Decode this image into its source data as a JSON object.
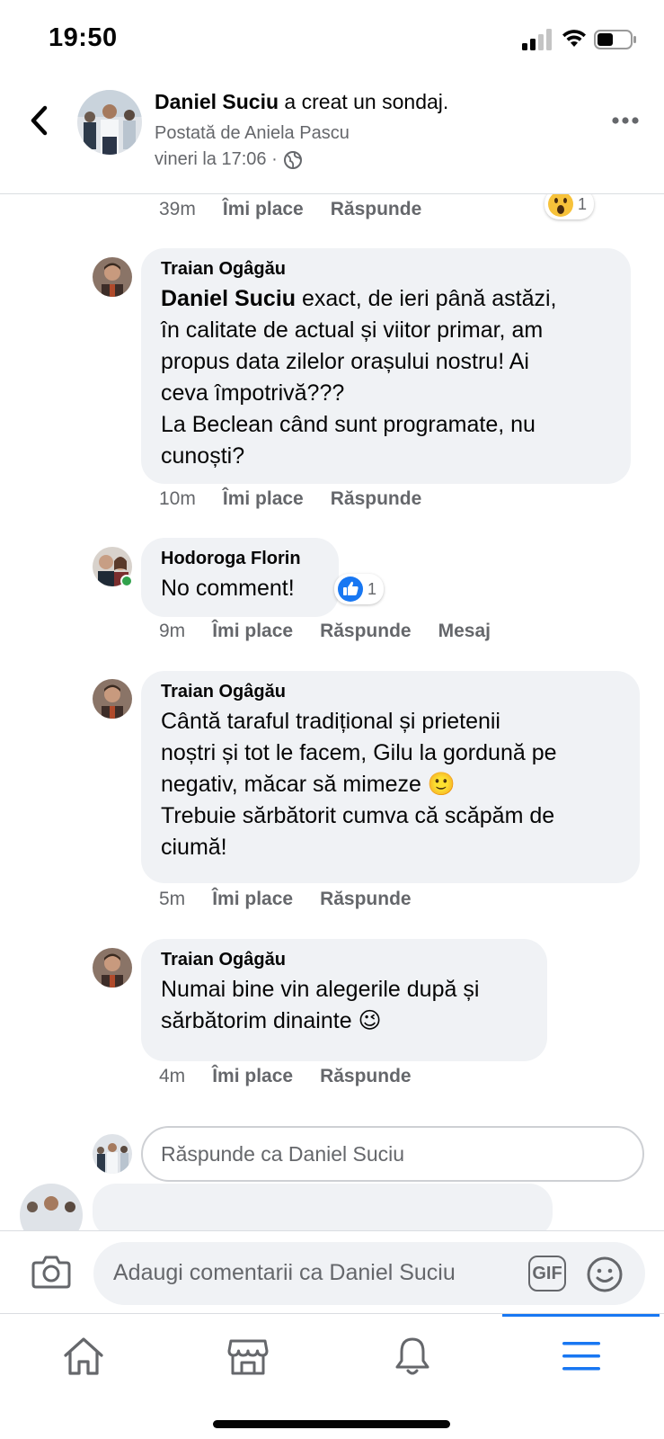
{
  "status": {
    "time": "19:50"
  },
  "header": {
    "author": "Daniel Suciu",
    "action": " a creat un sondaj.",
    "posted_by": "Postată de Aniela Pascu",
    "time": "vineri la 17:06 ·"
  },
  "comments": [
    {
      "meta": {
        "time": "39m",
        "like": "Îmi place",
        "reply": "Răspunde"
      },
      "reaction": {
        "icon": "wow-icon",
        "count": "1"
      }
    },
    {
      "author": "Traian Ogâgău",
      "mention": "Daniel Suciu",
      "text": " exact, de ieri până astăzi,\nîn calitate de actual și viitor primar, am\npropus data zilelor orașului nostru! Ai\nceva împotrivă???\nLa Beclean când sunt programate, nu\ncunoști?",
      "meta": {
        "time": "10m",
        "like": "Îmi place",
        "reply": "Răspunde"
      }
    },
    {
      "author": "Hodoroga Florin",
      "text": "No comment!",
      "reaction": {
        "icon": "like-icon",
        "count": "1"
      },
      "meta": {
        "time": "9m",
        "like": "Îmi place",
        "reply": "Răspunde",
        "message": "Mesaj"
      }
    },
    {
      "author": "Traian Ogâgău",
      "text": "Cântă taraful tradițional și prietenii\nnoștri și tot le facem, Gilu la gordună pe\nnegativ, măcar să mimeze 🙂\nTrebuie sărbătorit cumva că scăpăm de\nciumă!",
      "meta": {
        "time": "5m",
        "like": "Îmi place",
        "reply": "Răspunde"
      }
    },
    {
      "author": "Traian Ogâgău",
      "text": "Numai bine vin alegerile după și\nsărbătorim dinainte 😉",
      "meta": {
        "time": "4m",
        "like": "Îmi place",
        "reply": "Răspunde"
      }
    }
  ],
  "reply_box": {
    "placeholder": "Răspunde ca Daniel Suciu"
  },
  "composer": {
    "placeholder": "Adaugi comentarii ca Daniel Suciu",
    "gif": "GIF"
  },
  "tabs": [
    "home-icon",
    "marketplace-icon",
    "notifications-icon",
    "menu-icon"
  ],
  "colors": {
    "accent": "#1877f2",
    "bubble": "#f0f2f5",
    "secondary_text": "#65676b"
  }
}
